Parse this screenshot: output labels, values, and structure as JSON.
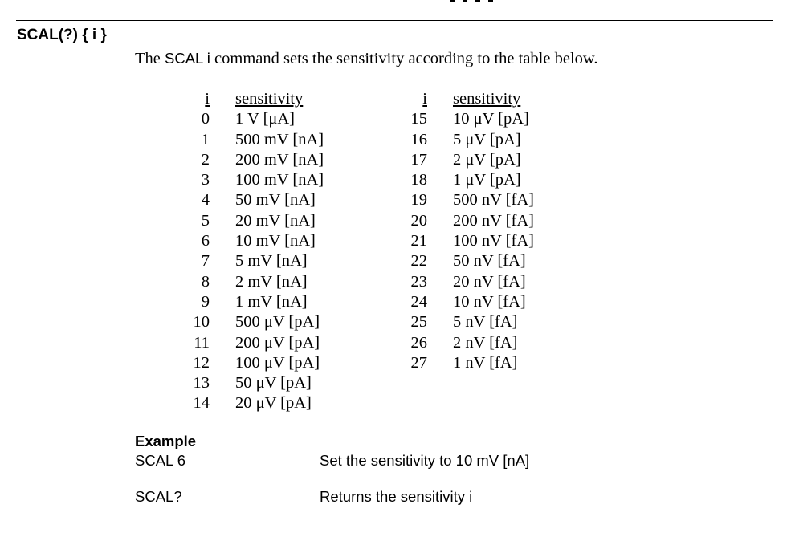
{
  "command": {
    "title": "SCAL(?) { i }",
    "description_pre": "The ",
    "description_cmd": "SCAL i",
    "description_post": " command sets the sensitivity according to the table below."
  },
  "table": {
    "header_i": "i",
    "header_sensitivity": "sensitivity",
    "left": [
      {
        "i": "0",
        "s": "1 V [μA]"
      },
      {
        "i": "1",
        "s": "500 mV [nA]"
      },
      {
        "i": "2",
        "s": "200 mV [nA]"
      },
      {
        "i": "3",
        "s": "100 mV [nA]"
      },
      {
        "i": "4",
        "s": "50 mV [nA]"
      },
      {
        "i": "5",
        "s": "20 mV [nA]"
      },
      {
        "i": "6",
        "s": "10 mV [nA]"
      },
      {
        "i": "7",
        "s": "5 mV [nA]"
      },
      {
        "i": "8",
        "s": "2 mV [nA]"
      },
      {
        "i": "9",
        "s": "1 mV [nA]"
      },
      {
        "i": "10",
        "s": "500 μV [pA]"
      },
      {
        "i": "11",
        "s": "200 μV [pA]"
      },
      {
        "i": "12",
        "s": "100 μV [pA]"
      },
      {
        "i": "13",
        "s": "50 μV [pA]"
      },
      {
        "i": "14",
        "s": "20 μV [pA]"
      }
    ],
    "right": [
      {
        "i": "15",
        "s": "10 μV [pA]"
      },
      {
        "i": "16",
        "s": "5 μV [pA]"
      },
      {
        "i": "17",
        "s": "2 μV [pA]"
      },
      {
        "i": "18",
        "s": "1 μV [pA]"
      },
      {
        "i": "19",
        "s": "500 nV [fA]"
      },
      {
        "i": "20",
        "s": "200 nV [fA]"
      },
      {
        "i": "21",
        "s": "100 nV [fA]"
      },
      {
        "i": "22",
        "s": "50 nV [fA]"
      },
      {
        "i": "23",
        "s": "20 nV [fA]"
      },
      {
        "i": "24",
        "s": "10 nV [fA]"
      },
      {
        "i": "25",
        "s": "5 nV [fA]"
      },
      {
        "i": "26",
        "s": "2 nV [fA]"
      },
      {
        "i": "27",
        "s": "1 nV [fA]"
      }
    ]
  },
  "example": {
    "heading": "Example",
    "items": [
      {
        "cmd": "SCAL 6",
        "desc": "Set the sensitivity to 10 mV [nA]"
      },
      {
        "cmd": "SCAL?",
        "desc": "Returns the sensitivity i"
      }
    ]
  }
}
